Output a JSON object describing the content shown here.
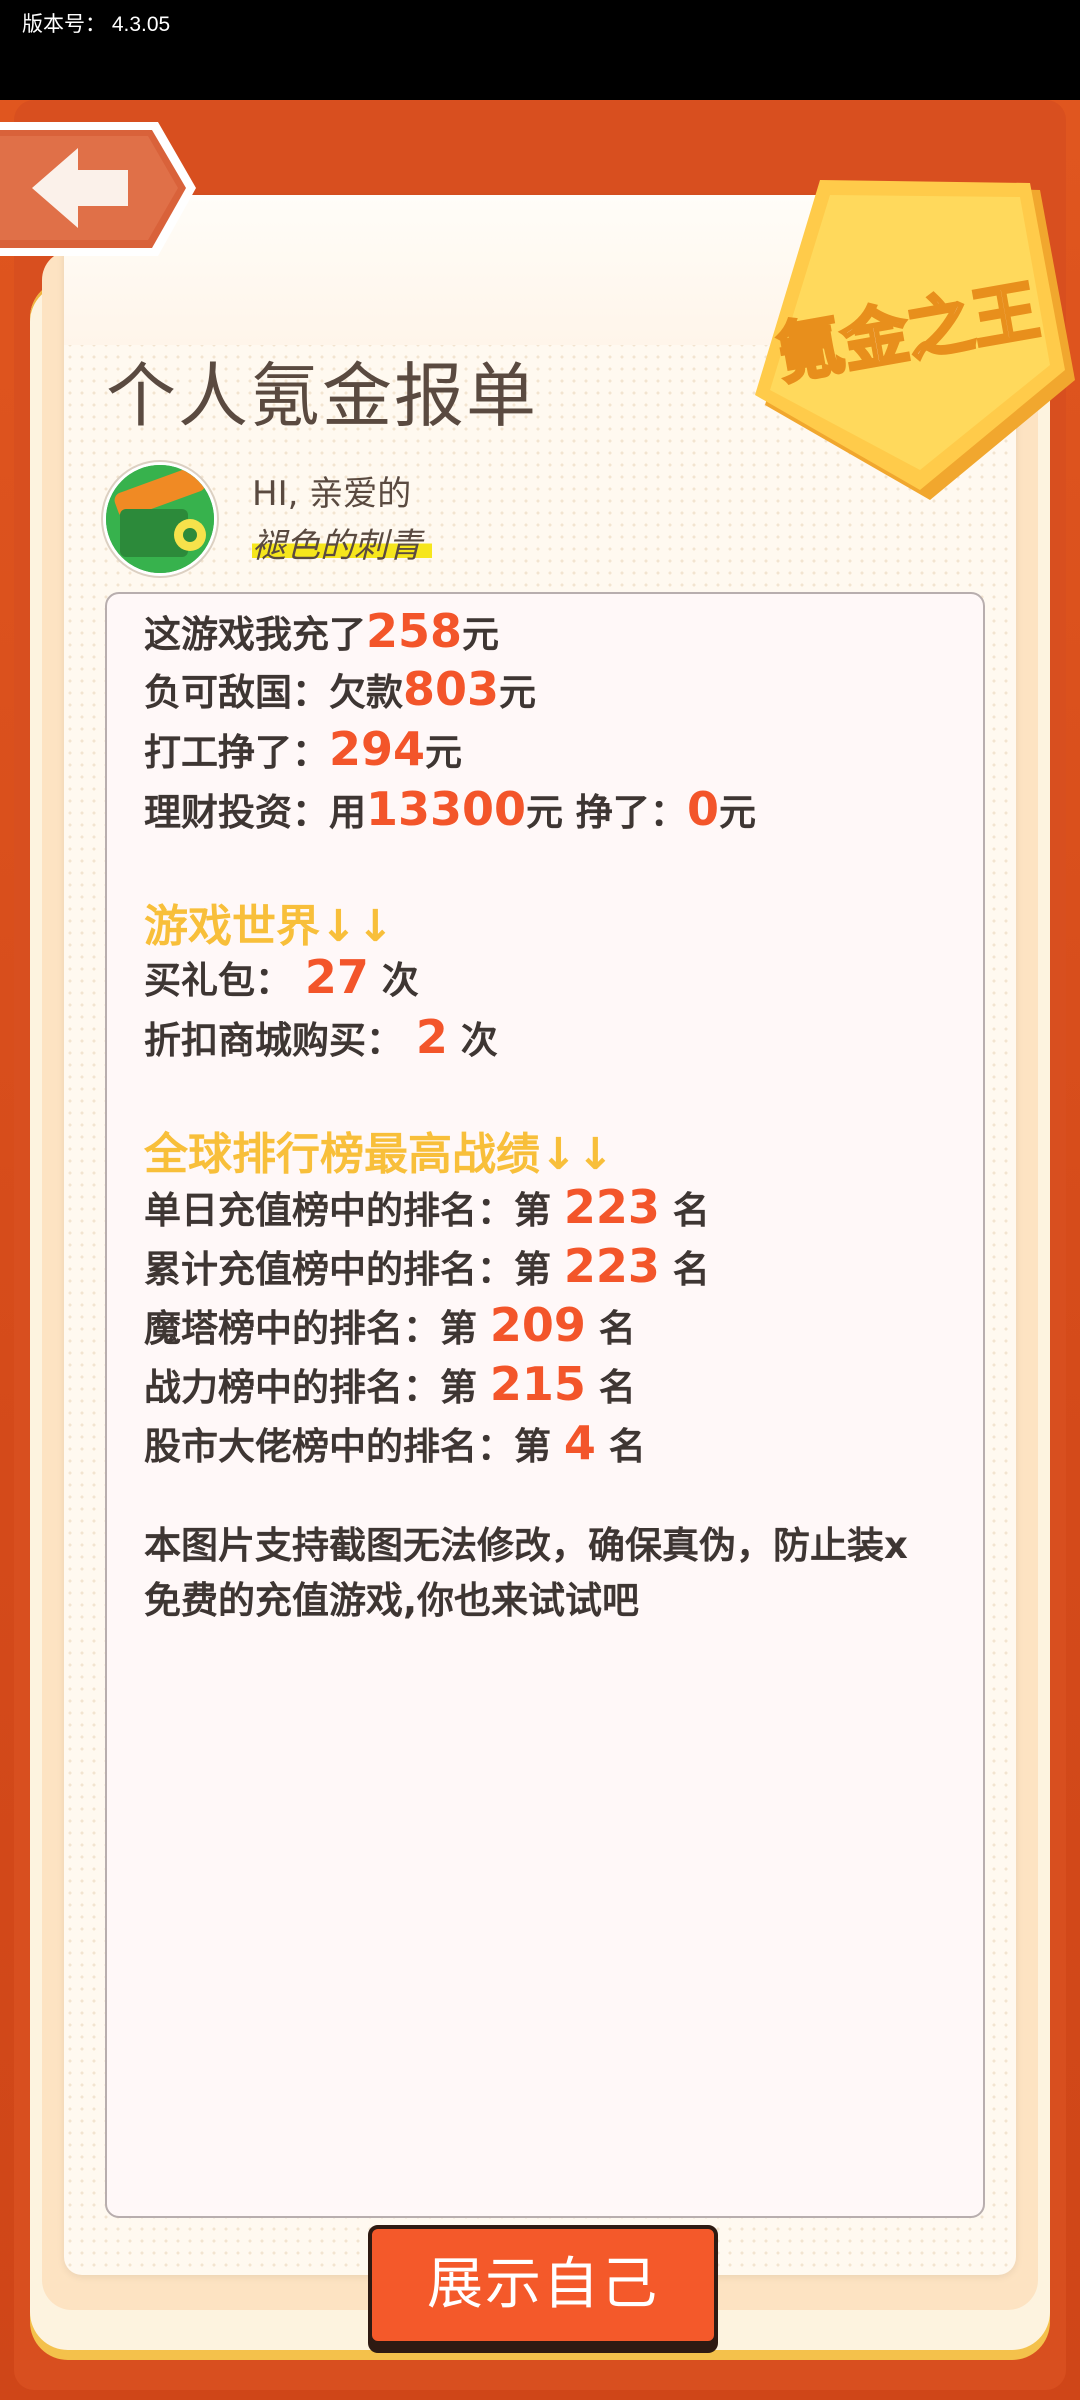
{
  "status_bar": {
    "version_text": "版本号： 4.3.05"
  },
  "header": {
    "title": "个人氪金报单",
    "badge_text": "氪金之王",
    "back_icon": "arrow-left-icon"
  },
  "profile": {
    "greeting": "HI, 亲爱的",
    "nickname": "褪色的刺青"
  },
  "report": {
    "recharge_prefix": "这游戏我充了",
    "recharge_amount": "258",
    "recharge_suffix": "元",
    "debt_prefix": "负可敌国：欠款",
    "debt_amount": "803",
    "debt_suffix": "元",
    "work_prefix": "打工挣了：",
    "work_amount": "294",
    "work_suffix": "元",
    "invest_prefix": "理财投资：用",
    "invest_amount": "13300",
    "invest_mid": "元 挣了：",
    "invest_profit": "0",
    "invest_suffix": "元",
    "game_world_title": "游戏世界↓↓",
    "gift_prefix": "买礼包： ",
    "gift_count": "27",
    "gift_suffix": " 次",
    "shop_prefix": "折扣商城购买： ",
    "shop_count": "2",
    "shop_suffix": " 次",
    "ranking_title": "全球排行榜最高战绩↓↓",
    "rankings": [
      {
        "label": "单日充值榜中的排名：第 ",
        "value": "223",
        "suffix": " 名"
      },
      {
        "label": "累计充值榜中的排名：第 ",
        "value": "223",
        "suffix": " 名"
      },
      {
        "label": "魔塔榜中的排名：第 ",
        "value": "209",
        "suffix": " 名"
      },
      {
        "label": "战力榜中的排名：第 ",
        "value": "215",
        "suffix": " 名"
      },
      {
        "label": "股市大佬榜中的排名：第 ",
        "value": "4",
        "suffix": " 名"
      }
    ],
    "note_line1": "本图片支持截图无法修改，确保真伪，防止装x",
    "note_line2": "免费的充值游戏,你也来试试吧"
  },
  "footer": {
    "show_button_label": "展示自己"
  },
  "colors": {
    "accent": "#f3552a",
    "section": "#f8bf3a",
    "frame": "#d24b1c"
  }
}
